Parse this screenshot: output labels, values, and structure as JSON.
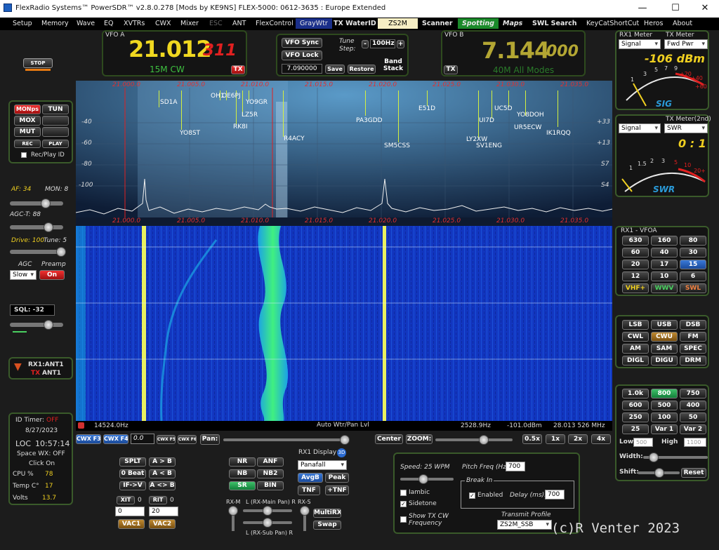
{
  "titlebar": {
    "title": "FlexRadio Systems™  PowerSDR™  v2.8.0.278  [Mods by KE9NS]  FLEX-5000: 0612-3635 : Europe Extended"
  },
  "menu": [
    {
      "label": "Setup"
    },
    {
      "label": "Memory"
    },
    {
      "label": "Wave"
    },
    {
      "label": "EQ"
    },
    {
      "label": "XVTRs"
    },
    {
      "label": "CWX"
    },
    {
      "label": "Mixer"
    },
    {
      "label": "ESC"
    },
    {
      "label": "ANT"
    },
    {
      "label": "FlexControl"
    },
    {
      "label": "GrayWtr"
    },
    {
      "label": "TX WaterID"
    },
    {
      "label": "ZS2M"
    },
    {
      "label": "Scanner"
    },
    {
      "label": "Spotting"
    },
    {
      "label": "Maps"
    },
    {
      "label": "SWL Search"
    },
    {
      "label": "KeyCatShortCut"
    },
    {
      "label": "Heros"
    },
    {
      "label": "About"
    }
  ],
  "vfoA": {
    "title": "VFO A",
    "freq_main": "21.012",
    "freq_sub": "311",
    "mode": "15M CW",
    "tx": "TX"
  },
  "vfoB": {
    "title": "VFO B",
    "freq_main": "7.144",
    "freq_sub": "000",
    "mode": "40M All Modes",
    "tx": "TX"
  },
  "vfoCenter": {
    "sync": "VFO Sync",
    "lock": "VFO Lock",
    "tune_label": "Tune Step:",
    "step": "100Hz",
    "minus": "-",
    "plus": "+",
    "mem_freq": "7.090000",
    "save": "Save",
    "restore": "Restore",
    "band_stack": "Band Stack"
  },
  "left": {
    "stop": "STOP",
    "monps": "MONps",
    "tun": "TUN",
    "mox": "MOX",
    "mut": "MUT",
    "rec": "REC",
    "play": "PLAY",
    "recplay_id": "Rec/Play ID",
    "af": "AF: 34",
    "mon": "MON: 8",
    "agct": "AGC-T: 88",
    "drive": "Drive: 100",
    "tune": "Tune: 5",
    "agc_label": "AGC",
    "preamp_label": "Preamp",
    "agc": "Slow",
    "preamp": "On",
    "sql": "SQL: -32",
    "rx1ant": "RX1:ANT1",
    "tx_prefix": "TX",
    "tx_ant": "ANT1"
  },
  "info": {
    "idtimer": "ID Timer:",
    "idtimer_val": "OFF",
    "date": "8/27/2023",
    "loc": "LOC",
    "time": "10:57:14",
    "spacewx": "Space WX: OFF",
    "clickon": "Click On",
    "cpu_label": "CPU %",
    "cpu": "78",
    "temp_label": "Temp C°",
    "temp": "17",
    "volts_label": "Volts",
    "volts": "13.7"
  },
  "meters": {
    "rx1_label": "RX1 Meter",
    "tx_label": "TX Meter",
    "rx1_sel": "Signal",
    "tx_sel": "Fwd Pwr",
    "dbm": "-106 dBm",
    "sig": "SIG",
    "txm2_label": "TX Meter(2nd)",
    "sig_sel": "Signal",
    "swr_sel": "SWR",
    "swr_val": "0 : 1",
    "swr": "SWR",
    "scale1": [
      "1",
      "3",
      "5",
      "7",
      "9",
      "+20",
      "+40",
      "+60"
    ],
    "scale2": [
      "1",
      "1.5",
      "2",
      "3",
      "5",
      "10",
      "20+"
    ]
  },
  "spectrum": {
    "freqs": [
      "21.000.0",
      "21.005.0",
      "21.010.0",
      "21.015.0",
      "21.020.0",
      "21.025.0",
      "21.030.0",
      "21.035.0"
    ],
    "dbs": [
      "-40",
      "-60",
      "-80",
      "-100"
    ],
    "sunits": [
      "+33",
      "+13",
      "S7",
      "S4"
    ],
    "spots": [
      "SD1A",
      "OH1",
      "OE6PJ",
      "YO9GR",
      "LZ5R",
      "RK8I",
      "YO8ST",
      "R4ACY",
      "PA3GDD",
      "SM5CSS",
      "E51D",
      "UC5D",
      "YO8DOH",
      "UI7D",
      "UR5ECW",
      "IK1RQQ",
      "LY2XW",
      "SV1ENG"
    ]
  },
  "wfstatus": {
    "left": "14524.0Hz",
    "center": "Auto Wtr/Pan Lvl",
    "hz": "2528.9Hz",
    "dbm": "-101.0dBm",
    "mhz": "28.013 526 MHz"
  },
  "bandpanel": {
    "title": "RX1 - VFOA",
    "bands": [
      "630",
      "160",
      "80",
      "60",
      "40",
      "30",
      "20",
      "17",
      "15",
      "12",
      "10",
      "6",
      "VHF+",
      "WWV",
      "SWL"
    ]
  },
  "modes": [
    "LSB",
    "USB",
    "DSB",
    "CWL",
    "CWU",
    "FM",
    "AM",
    "SAM",
    "SPEC",
    "DIGL",
    "DIGU",
    "DRM"
  ],
  "filters": {
    "list": [
      "1.0k",
      "800",
      "750",
      "600",
      "500",
      "400",
      "250",
      "100",
      "50",
      "25",
      "Var 1",
      "Var 2"
    ],
    "low": "Low",
    "low_val": "500",
    "high": "High",
    "high_val": "1100",
    "width": "Width:",
    "shift": "Shift:",
    "reset": "Reset"
  },
  "toolbar": {
    "cwx_f3": "CWX F3",
    "cwx_f4": "CWX F4",
    "val": "0.0",
    "cwx_f5": "CWX F5",
    "cwx_f6": "CWX F6",
    "pan": "Pan:",
    "center": "Center",
    "zoom": "ZOOM:",
    "z05": "0.5x",
    "z1": "1x",
    "z2": "2x",
    "z4": "4x"
  },
  "bottom": {
    "splt": "SPLT",
    "atob": "A > B",
    "beat0": "0 Beat",
    "altb": "A < B",
    "ifv": "IF->V",
    "aswap": "A <> B",
    "xit": "XIT",
    "xit_val": "0",
    "rit": "RIT",
    "rit_val": "0",
    "xit_in": "0",
    "rit_in": "20",
    "vac1": "VAC1",
    "vac2": "VAC2",
    "nr": "NR",
    "anf": "ANF",
    "nb": "NB",
    "nb2": "NB2",
    "sr": "SR",
    "bin": "BIN",
    "rx1display": "RX1 Display",
    "disp_sel": "Panafall",
    "avgb": "AvgB",
    "peak": "Peak",
    "tnf": "TNF",
    "ptnf": "+TNF",
    "multirx": "MultiRX",
    "swap": "Swap",
    "rxm": "RX-M",
    "rxs": "RX-S",
    "lmain": "L (RX-Main Pan) R",
    "lsub": "L (RX-Sub Pan) R"
  },
  "cw": {
    "speed": "Speed:  25 WPM",
    "pitch": "Pitch Freq (Hz)",
    "pitch_val": "700",
    "iambic": "Iambic",
    "sidetone": "Sidetone",
    "showtx": "Show TX CW Frequency",
    "breakin": "Break In",
    "enabled": "Enabled",
    "delay": "Delay (ms):",
    "delay_val": "700",
    "txprofile": "Transmit Profile",
    "profile": "ZS2M_SSB"
  },
  "watermark": "(c)R Venter 2023"
}
